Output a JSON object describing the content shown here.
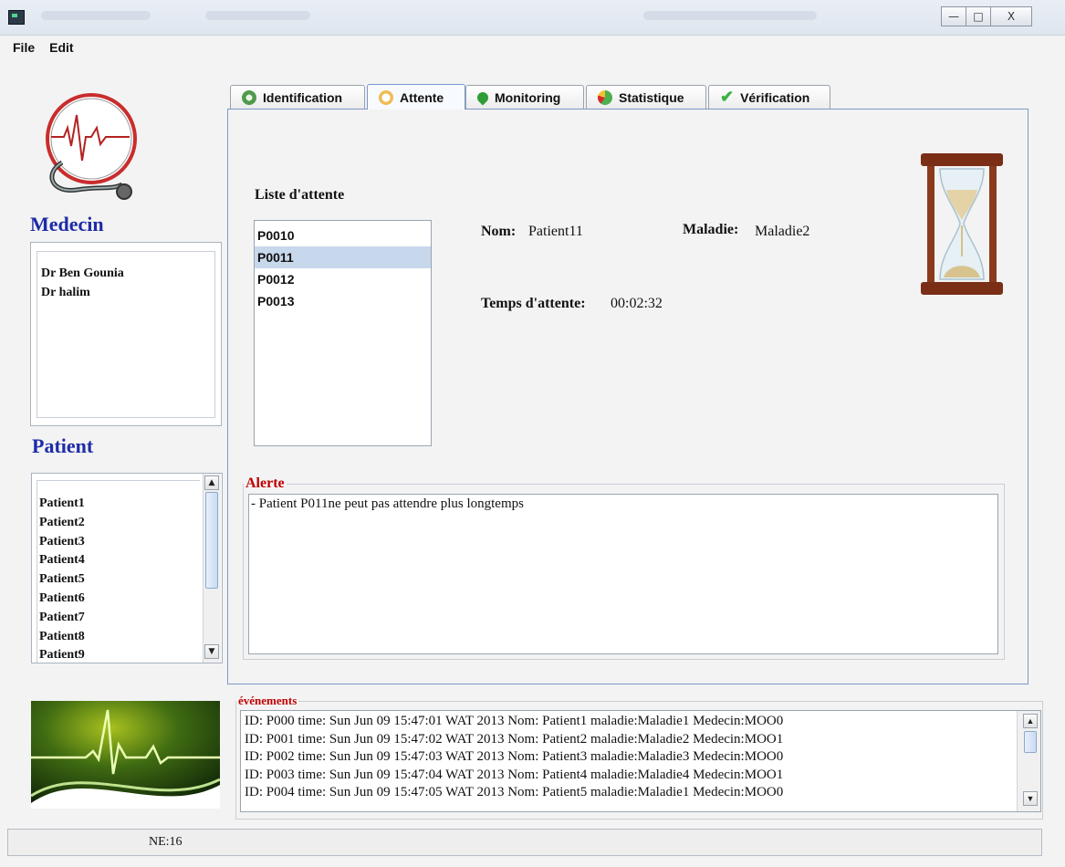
{
  "window": {
    "controls": {
      "minimize": "—",
      "maximize": "□",
      "close": "X"
    }
  },
  "menu": [
    "File",
    "Edit"
  ],
  "medecin": {
    "title": "Medecin",
    "items": [
      "Dr Ben Gounia",
      "Dr halim"
    ]
  },
  "patient": {
    "title": "Patient",
    "items": [
      "Patient1",
      "Patient2",
      "Patient3",
      "Patient4",
      "Patient5",
      "Patient6",
      "Patient7",
      "Patient8",
      "Patient9"
    ]
  },
  "tabs": [
    {
      "label": "Identification",
      "icon": "fingerprint-icon",
      "color": "#4f9a4b"
    },
    {
      "label": "Attente",
      "icon": "clock-icon",
      "color": "#f0bb55"
    },
    {
      "label": "Monitoring",
      "icon": "location-pin-icon",
      "color": "#2f9d35"
    },
    {
      "label": "Statistique",
      "icon": "pie-chart-icon",
      "color": "#4caf50"
    },
    {
      "label": "Vérification",
      "icon": "checkmark-icon",
      "color": "#38b243"
    }
  ],
  "active_tab": "Attente",
  "attente": {
    "list_title": "Liste d'attente",
    "list": [
      "P0010",
      "P0011",
      "P0012",
      "P0013"
    ],
    "selected": "P0011",
    "nom_label": "Nom:",
    "nom_value": "Patient11",
    "maladie_label": "Maladie:",
    "maladie_value": "Maladie2",
    "temps_label": "Temps d'attente:",
    "temps_value": "00:02:32"
  },
  "alerte": {
    "title": "Alerte",
    "text": "- Patient P011ne peut pas attendre plus longtemps"
  },
  "events": {
    "title": "événements",
    "lines": [
      "ID: P000 time: Sun Jun 09 15:47:01 WAT 2013 Nom: Patient1 maladie:Maladie1 Medecin:MOO0",
      "ID: P001 time: Sun Jun 09 15:47:02 WAT 2013 Nom: Patient2 maladie:Maladie2 Medecin:MOO1",
      "ID: P002 time: Sun Jun 09 15:47:03 WAT 2013 Nom: Patient3 maladie:Maladie3 Medecin:MOO0",
      "ID: P003 time: Sun Jun 09 15:47:04 WAT 2013 Nom: Patient4 maladie:Maladie4 Medecin:MOO1",
      "ID: P004 time: Sun Jun 09 15:47:05 WAT 2013 Nom: Patient5 maladie:Maladie1 Medecin:MOO0"
    ]
  },
  "status": {
    "text": "NE:16"
  },
  "colors": {
    "section_title": "#1d2ba8",
    "legend": "#c00000",
    "selection": "#c8d8ec",
    "tab_border_active": "#7d98c8"
  }
}
